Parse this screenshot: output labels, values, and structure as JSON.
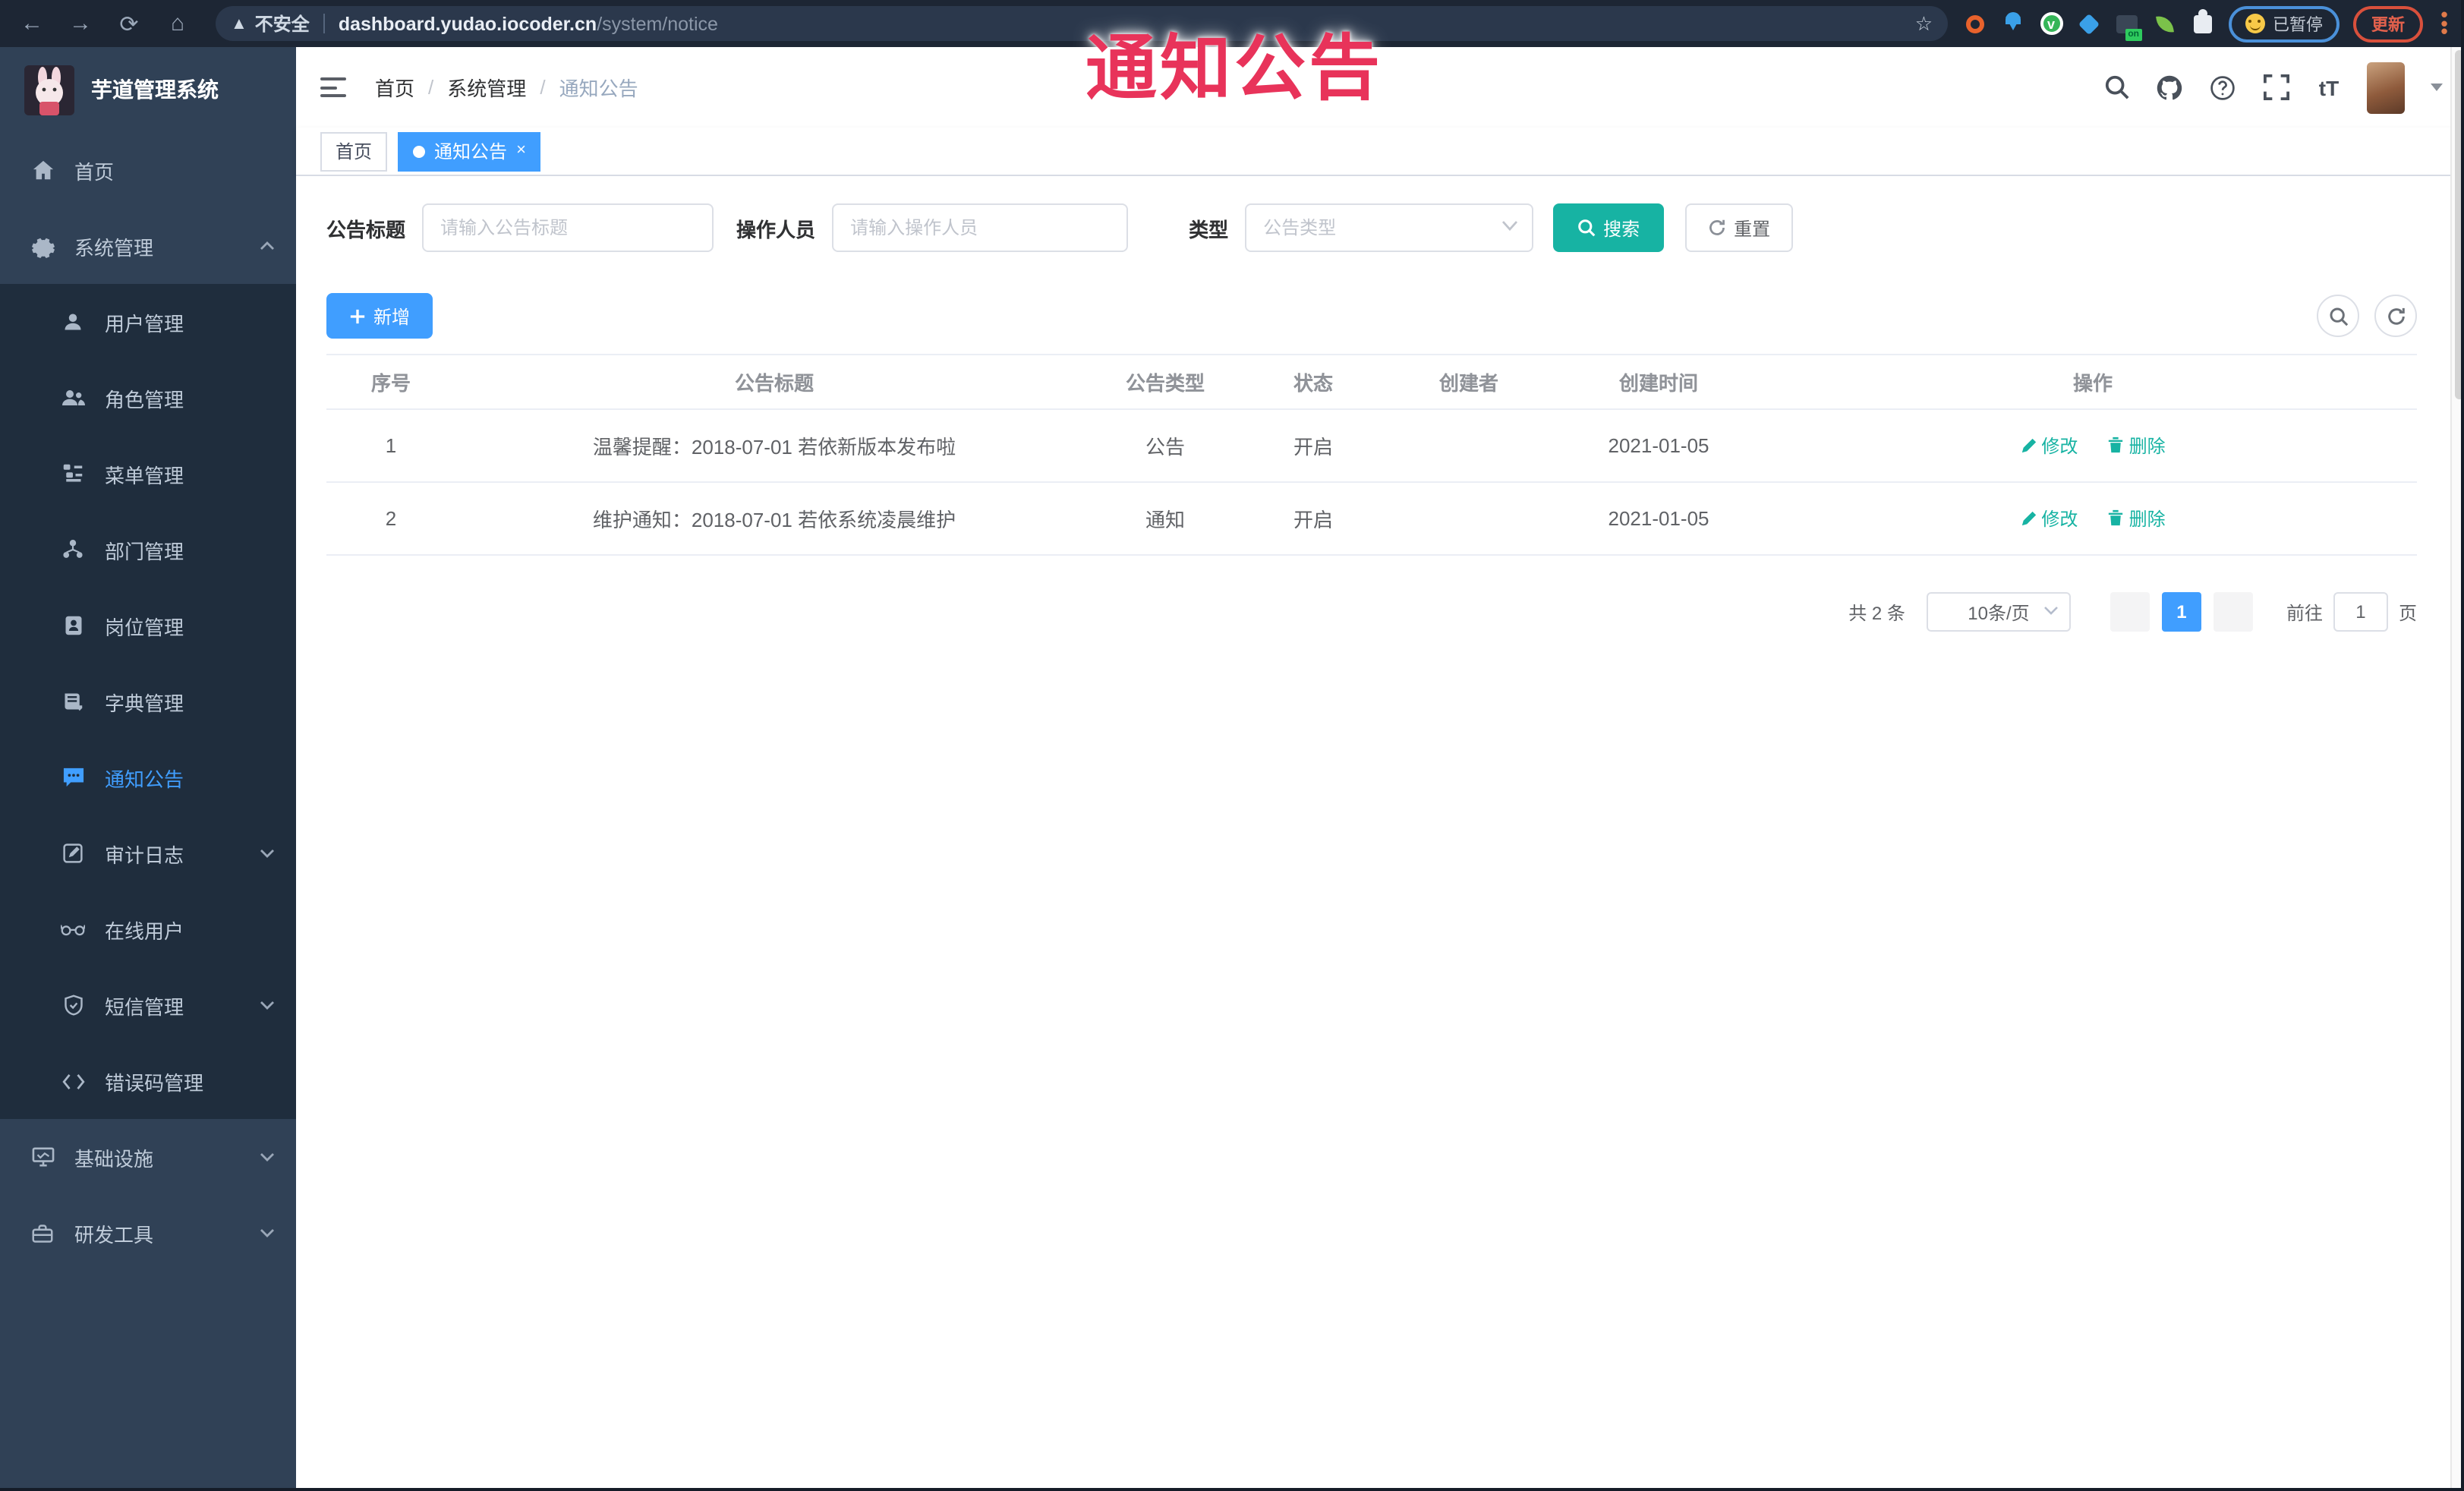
{
  "overlay": {
    "title": "通知公告"
  },
  "browser": {
    "security_label": "不安全",
    "url_host": "dashboard.yudao.iocoder.cn",
    "url_path": "/system/notice",
    "on_badge": "on",
    "paused_badge": "已暂停",
    "update_button": "更新"
  },
  "sidebar": {
    "title": "芋道管理系统",
    "top_items": [
      {
        "label": "首页"
      },
      {
        "label": "系统管理"
      }
    ],
    "submenu": [
      {
        "label": "用户管理"
      },
      {
        "label": "角色管理"
      },
      {
        "label": "菜单管理"
      },
      {
        "label": "部门管理"
      },
      {
        "label": "岗位管理"
      },
      {
        "label": "字典管理"
      },
      {
        "label": "通知公告"
      },
      {
        "label": "审计日志"
      },
      {
        "label": "在线用户"
      },
      {
        "label": "短信管理"
      },
      {
        "label": "错误码管理"
      }
    ],
    "bottom_items": [
      {
        "label": "基础设施"
      },
      {
        "label": "研发工具"
      }
    ]
  },
  "navbar": {
    "breadcrumb": [
      {
        "label": "首页"
      },
      {
        "label": "系统管理"
      },
      {
        "label": "通知公告"
      }
    ]
  },
  "tabs": [
    {
      "label": "首页"
    },
    {
      "label": "通知公告"
    }
  ],
  "filters": {
    "title_label": "公告标题",
    "title_placeholder": "请输入公告标题",
    "operator_label": "操作人员",
    "operator_placeholder": "请输入操作人员",
    "type_label": "类型",
    "type_placeholder": "公告类型",
    "search_button": "搜索",
    "reset_button": "重置"
  },
  "toolbar": {
    "add_button": "新增"
  },
  "table": {
    "headers": [
      "序号",
      "公告标题",
      "公告类型",
      "状态",
      "创建者",
      "创建时间",
      "操作"
    ],
    "rows": [
      {
        "seq": "1",
        "title": "温馨提醒：2018-07-01 若依新版本发布啦",
        "type": "公告",
        "status": "开启",
        "creator": "",
        "create_time": "2021-01-05"
      },
      {
        "seq": "2",
        "title": "维护通知：2018-07-01 若依系统凌晨维护",
        "type": "通知",
        "status": "开启",
        "creator": "",
        "create_time": "2021-01-05"
      }
    ],
    "actions": {
      "edit": "修改",
      "delete": "删除"
    }
  },
  "pagination": {
    "total": "共 2 条",
    "page_size": "10条/页",
    "current": "1",
    "goto_label": "前往",
    "goto_value": "1",
    "page_unit": "页"
  },
  "colors": {
    "primary": "#409eff",
    "teal": "#17b3a3",
    "overlay_red": "#e8335a",
    "sidebar": "#304156",
    "submenu": "#1f2d3d"
  }
}
